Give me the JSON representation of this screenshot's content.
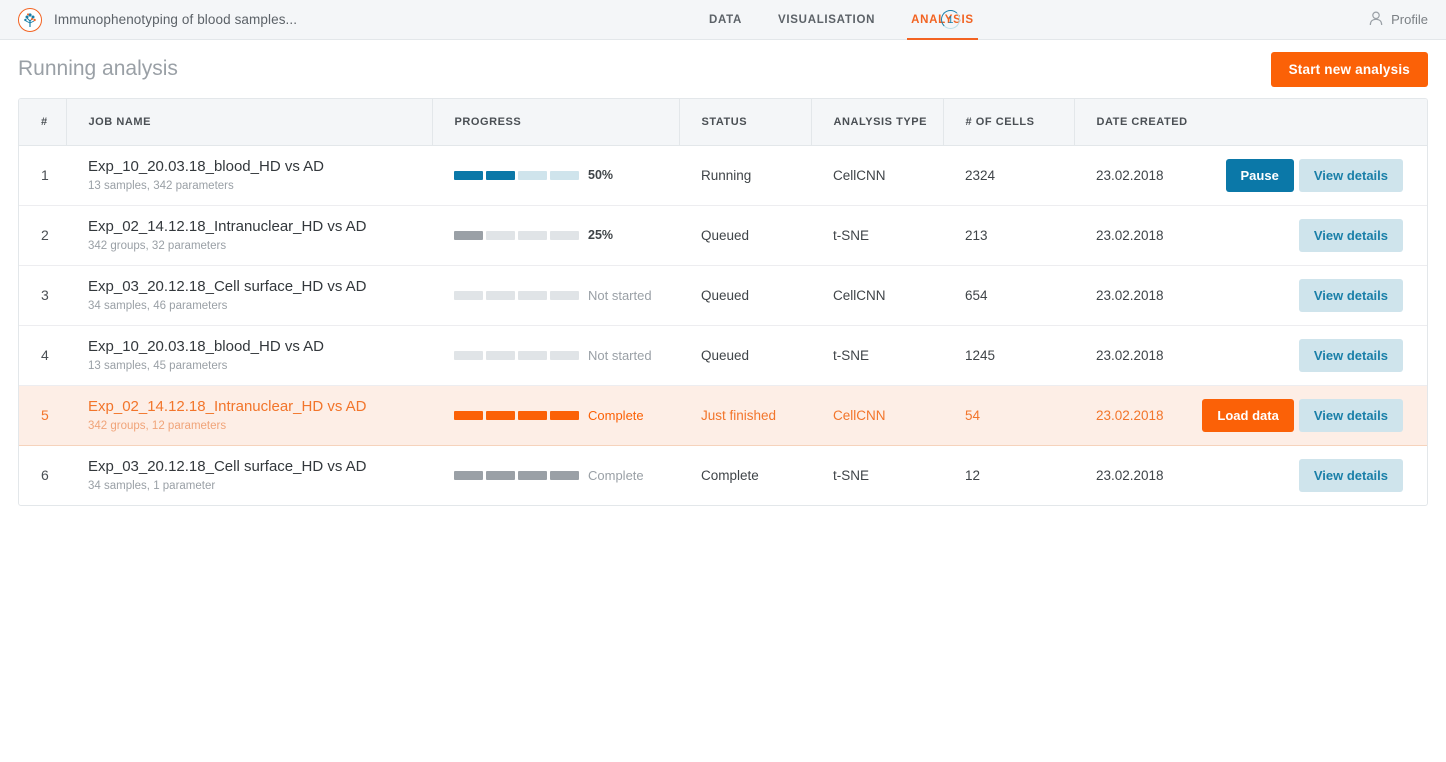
{
  "topbar": {
    "logo_icon": "tree-network-logo-icon",
    "brand_title": "Immunophenotyping of blood samples...",
    "nav": [
      {
        "label": "DATA",
        "active": false
      },
      {
        "label": "VISUALISATION",
        "active": false
      },
      {
        "label": "ANALYSIS",
        "active": true
      }
    ],
    "nav_badge_count": "1",
    "profile_icon": "user-icon",
    "profile_label": "Profile"
  },
  "header": {
    "title": "Running analysis",
    "start_button": "Start new analysis"
  },
  "table": {
    "columns": {
      "num": "#",
      "job_name": "JOB NAME",
      "progress": "PROGRESS",
      "status": "STATUS",
      "analysis_type": "ANALYSIS TYPE",
      "cells": "# OF CELLS",
      "date": "DATE CREATED",
      "actions": ""
    },
    "rows": [
      {
        "num": "1",
        "job_name": "Exp_10_20.03.18_blood_HD vs AD",
        "job_meta": "13 samples, 342 parameters",
        "progress_label": "50%",
        "progress_filled": 2,
        "progress_total": 4,
        "progress_style": "blue",
        "status": "Running",
        "analysis_type": "CellCNN",
        "cells": "2324",
        "date": "23.02.2018",
        "buttons": [
          "Pause",
          "View details"
        ],
        "highlighted": false
      },
      {
        "num": "2",
        "job_name": "Exp_02_14.12.18_Intranuclear_HD vs AD",
        "job_meta": "342 groups, 32 parameters",
        "progress_label": "25%",
        "progress_filled": 1,
        "progress_total": 4,
        "progress_style": "gray",
        "status": "Queued",
        "analysis_type": "t-SNE",
        "cells": "213",
        "date": "23.02.2018",
        "buttons": [
          "View details"
        ],
        "highlighted": false
      },
      {
        "num": "3",
        "job_name": "Exp_03_20.12.18_Cell surface_HD vs AD",
        "job_meta": "34 samples, 46 parameters",
        "progress_label": "Not started",
        "progress_filled": 0,
        "progress_total": 4,
        "progress_style": "gray",
        "status": "Queued",
        "analysis_type": "CellCNN",
        "cells": "654",
        "date": "23.02.2018",
        "buttons": [
          "View details"
        ],
        "highlighted": false
      },
      {
        "num": "4",
        "job_name": "Exp_10_20.03.18_blood_HD vs AD",
        "job_meta": "13 samples, 45 parameters",
        "progress_label": "Not started",
        "progress_filled": 0,
        "progress_total": 4,
        "progress_style": "gray",
        "status": "Queued",
        "analysis_type": "t-SNE",
        "cells": "1245",
        "date": "23.02.2018",
        "buttons": [
          "View details"
        ],
        "highlighted": false
      },
      {
        "num": "5",
        "job_name": "Exp_02_14.12.18_Intranuclear_HD vs AD",
        "job_meta": "342 groups, 12 parameters",
        "progress_label": "Complete",
        "progress_filled": 4,
        "progress_total": 4,
        "progress_style": "orange",
        "status": "Just finished",
        "analysis_type": "CellCNN",
        "cells": "54",
        "date": "23.02.2018",
        "buttons": [
          "Load data",
          "View details"
        ],
        "highlighted": true
      },
      {
        "num": "6",
        "job_name": "Exp_03_20.12.18_Cell surface_HD vs AD",
        "job_meta": "34 samples, 1 parameter",
        "progress_label": "Complete",
        "progress_filled": 4,
        "progress_total": 4,
        "progress_style": "gray",
        "status": "Complete",
        "analysis_type": "t-SNE",
        "cells": "12",
        "date": "23.02.2018",
        "buttons": [
          "View details"
        ],
        "highlighted": false
      }
    ]
  },
  "colors": {
    "accent_orange": "#fb6107",
    "accent_teal": "#0b78a8",
    "teal_light": "#cfe4ec",
    "highlight_row_bg": "#fdeee6",
    "header_bg": "#f4f6f8"
  }
}
